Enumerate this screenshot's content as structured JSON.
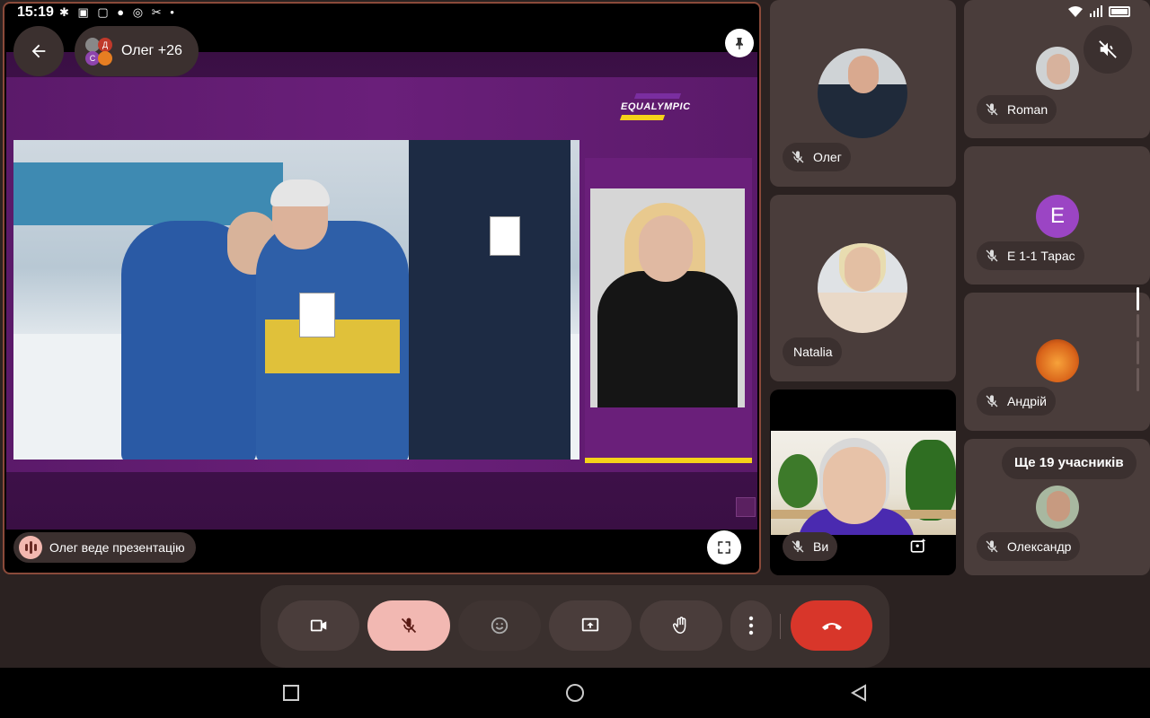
{
  "status_bar": {
    "time": "15:19"
  },
  "presentation": {
    "participants_chip_label": "Олег +26",
    "presenting_label": "Олег веде презентацію",
    "slide_brand": "EQUALYMPIC",
    "icons": {
      "back": "back-arrow-icon",
      "pin": "pin-icon",
      "fullscreen": "fullscreen-icon",
      "presenting": "presenting-icon"
    }
  },
  "tiles": [
    {
      "name": "Олег",
      "mic_muted": true
    },
    {
      "name": "Natalia",
      "mic_muted": false
    },
    {
      "name": "Ви",
      "mic_muted": true
    },
    {
      "name": "Roman",
      "mic_muted": true
    },
    {
      "name": "Е 1-1 Тарас",
      "mic_muted": true,
      "avatar_letter": "E",
      "avatar_color": "#9b45c4"
    },
    {
      "name": "Андрій",
      "mic_muted": true
    },
    {
      "name": "Олександр",
      "mic_muted": true
    }
  ],
  "more_participants": "Ще 19 учасників",
  "controls": {
    "camera_icon": "camera-icon",
    "mic_icon": "mic-off-icon",
    "emoji_icon": "emoji-icon",
    "present_icon": "present-screen-icon",
    "hand_icon": "raise-hand-icon",
    "more_icon": "more-vert-icon",
    "end_icon": "end-call-icon"
  },
  "colors": {
    "end_call": "#d8362a",
    "mic_active_bg": "#f2b8b2",
    "accent_purple": "#6a1f7a",
    "accent_yellow": "#f5d21a"
  }
}
